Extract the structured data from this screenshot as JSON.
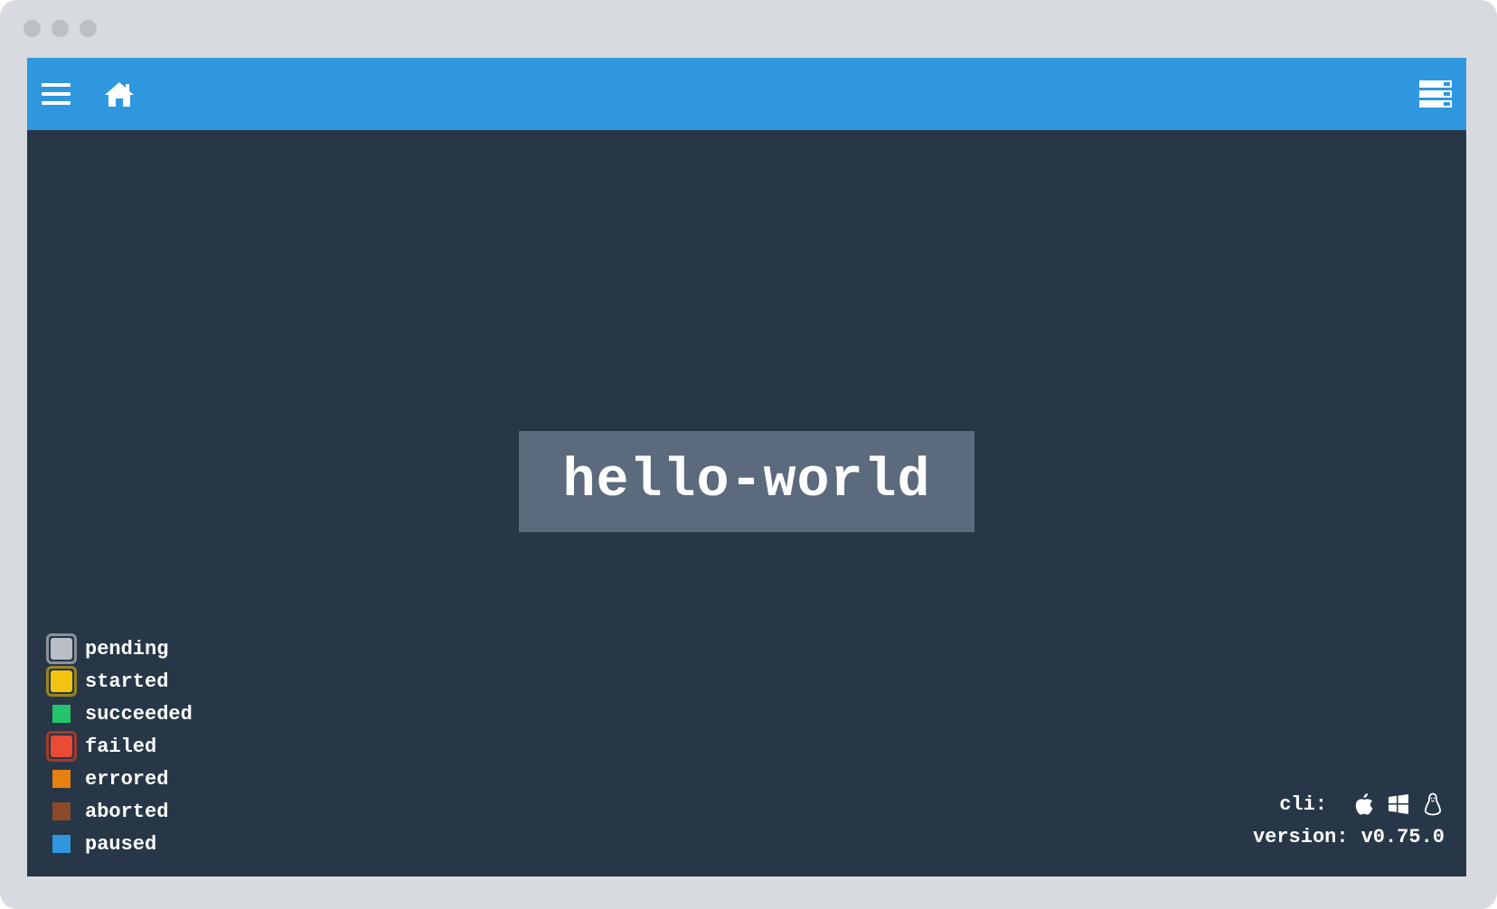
{
  "window": {
    "traffic_lights": [
      "close",
      "minimize",
      "maximize"
    ]
  },
  "topbar": {
    "background": "#2e97de",
    "left_icons": [
      "hamburger-icon",
      "home-icon"
    ],
    "right_icon": "sidebar-toggle-icon"
  },
  "pipeline": {
    "job_name": "hello-world",
    "job_color": "#5b6a7c"
  },
  "legend": {
    "items": [
      {
        "label": "pending",
        "color": "#b9bec6",
        "ring": "#8b9099"
      },
      {
        "label": "started",
        "color": "#f2c30f",
        "ring": "#9a8420"
      },
      {
        "label": "succeeded",
        "color": "#23c46a"
      },
      {
        "label": "failed",
        "color": "#e94b35",
        "ring": "#a33a2c"
      },
      {
        "label": "errored",
        "color": "#e6800f"
      },
      {
        "label": "aborted",
        "color": "#8a4a2a"
      },
      {
        "label": "paused",
        "color": "#2e97de"
      }
    ]
  },
  "footer": {
    "cli_label": "cli:",
    "cli_icons": [
      "apple-icon",
      "windows-icon",
      "linux-icon"
    ],
    "version_label": "version:",
    "version_value": "v0.75.0"
  }
}
